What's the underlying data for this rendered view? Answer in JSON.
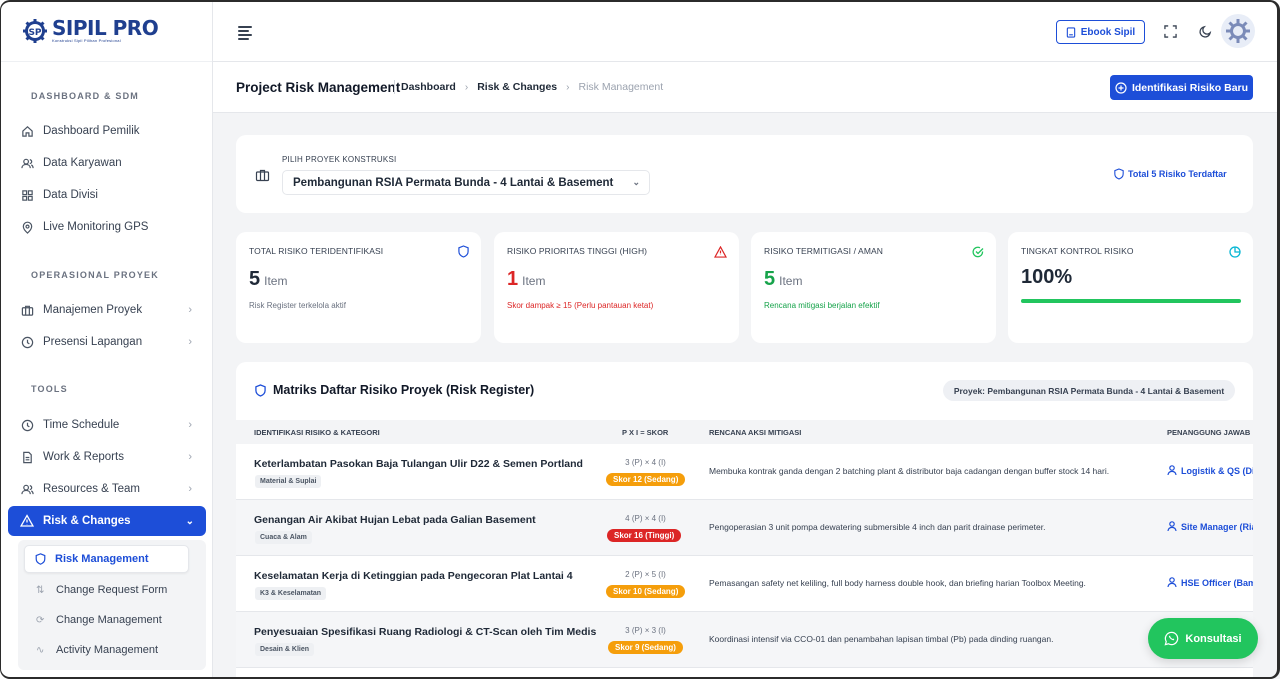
{
  "brand": {
    "name": "SIPIL PRO",
    "tagline": "Konstruksi Sipil Pilihan Profesional",
    "logo_letters": "SP"
  },
  "sidebar": {
    "sections": {
      "dashboard": "DASHBOARD & SDM",
      "operasional": "OPERASIONAL PROYEK",
      "tools": "TOOLS"
    },
    "items": [
      {
        "label": "Dashboard Pemilik",
        "icon": "home-icon"
      },
      {
        "label": "Data Karyawan",
        "icon": "users-icon"
      },
      {
        "label": "Data Divisi",
        "icon": "grid-icon"
      },
      {
        "label": "Live Monitoring GPS",
        "icon": "map-pin-icon"
      },
      {
        "label": "Manajemen Proyek",
        "icon": "briefcase-icon"
      },
      {
        "label": "Presensi Lapangan",
        "icon": "clock-icon"
      },
      {
        "label": "Time Schedule",
        "icon": "clock-icon"
      },
      {
        "label": "Work & Reports",
        "icon": "file-icon"
      },
      {
        "label": "Resources & Team",
        "icon": "users-icon"
      }
    ],
    "active": {
      "label": "Risk & Changes",
      "icon": "warning-icon"
    },
    "subitems": [
      {
        "label": "Risk Management",
        "icon": "shield-icon"
      },
      {
        "label": "Change Request Form",
        "icon": "swap-icon"
      },
      {
        "label": "Change Management",
        "icon": "refresh-icon"
      },
      {
        "label": "Activity Management",
        "icon": "activity-icon"
      }
    ]
  },
  "topbar": {
    "ebook_label": "Ebook Sipil"
  },
  "header": {
    "title": "Project Risk Management",
    "breadcrumb": [
      "Dashboard",
      "Risk & Changes",
      "Risk Management"
    ],
    "new_risk_label": "Identifikasi Risiko Baru"
  },
  "project": {
    "label": "PILIH PROYEK KONSTRUKSI",
    "selected": "Pembangunan RSIA Permata Bunda - 4 Lantai & Basement",
    "total": "Total 5 Risiko Terdaftar"
  },
  "stats": [
    {
      "label": "TOTAL RISIKO TERIDENTIFIKASI",
      "value": "5",
      "unit": "Item",
      "note": "Risk Register terkelola aktif",
      "color": "#1f2937",
      "note_color": "#6b7280",
      "icon": "shield-icon"
    },
    {
      "label": "RISIKO PRIORITAS TINGGI (HIGH)",
      "value": "1",
      "unit": "Item",
      "note": "Skor dampak ≥ 15 (Perlu pantauan ketat)",
      "color": "#dc2626",
      "note_color": "#dc2626",
      "icon": "warning-icon"
    },
    {
      "label": "RISIKO TERMITIGASI / AMAN",
      "value": "5",
      "unit": "Item",
      "note": "Rencana mitigasi berjalan efektif",
      "color": "#16a34a",
      "note_color": "#16a34a",
      "icon": "check-circle-icon"
    },
    {
      "label": "TINGKAT KONTROL RISIKO",
      "value": "100%",
      "progress": 1.0,
      "color": "#1f2937",
      "icon": "pie-icon"
    }
  ],
  "register": {
    "title": "Matriks Daftar Risiko Proyek (Risk Register)",
    "project_badge": "Proyek: Pembangunan RSIA Permata Bunda - 4 Lantai & Basement",
    "columns": [
      "IDENTIFIKASI RISIKO & KATEGORI",
      "P X I = SKOR",
      "RENCANA AKSI MITIGASI",
      "PENANGGUNG JAWAB"
    ],
    "rows": [
      {
        "title": "Keterlambatan Pasokan Baja Tulangan Ulir D22 & Semen Portland",
        "category": "Material & Suplai",
        "px": "3 (P) × 4 (I)",
        "score": "Skor 12 (Sedang)",
        "level": "medium",
        "mitigation": "Membuka kontrak ganda dengan 2 batching plant & distributor baja cadangan dengan buffer stock 14 hari.",
        "pic": "Logistik & QS (Dir"
      },
      {
        "title": "Genangan Air Akibat Hujan Lebat pada Galian Basement",
        "category": "Cuaca & Alam",
        "px": "4 (P) × 4 (I)",
        "score": "Skor 16 (Tinggi)",
        "level": "high",
        "mitigation": "Pengoperasian 3 unit pompa dewatering submersible 4 inch dan parit drainase perimeter.",
        "pic": "Site Manager (Ria"
      },
      {
        "title": "Keselamatan Kerja di Ketinggian pada Pengecoran Plat Lantai 4",
        "category": "K3 & Keselamatan",
        "px": "2 (P) × 5 (I)",
        "score": "Skor 10 (Sedang)",
        "level": "medium",
        "mitigation": "Pemasangan safety net keliling, full body harness double hook, dan briefing harian Toolbox Meeting.",
        "pic": "HSE Officer (Bam"
      },
      {
        "title": "Penyesuaian Spesifikasi Ruang Radiologi & CT-Scan oleh Tim Medis",
        "category": "Desain & Klien",
        "px": "3 (P) × 3 (I)",
        "score": "Skor 9 (Sedang)",
        "level": "medium",
        "mitigation": "Koordinasi intensif via CCO-01 dan penambahan lapisan timbal (Pb) pada dinding ruangan.",
        "pic": ""
      }
    ]
  },
  "fab": {
    "label": "Konsultasi"
  },
  "colors": {
    "primary": "#1d4ed8",
    "high": "#dc2626",
    "medium": "#f59e0b",
    "success": "#22c55e"
  }
}
